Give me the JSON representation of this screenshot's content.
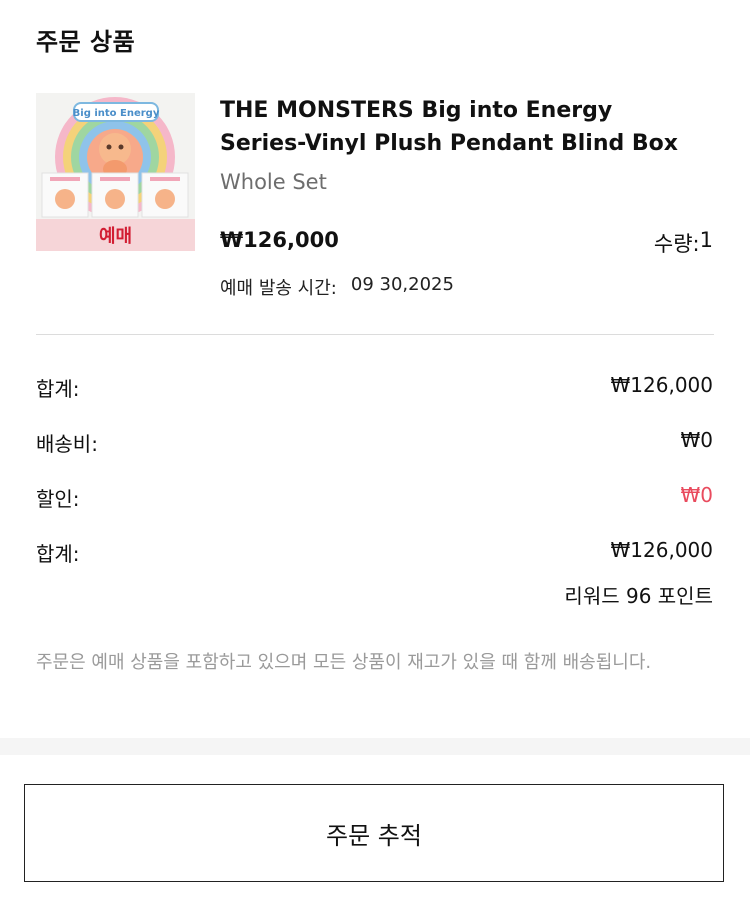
{
  "section_title": "주문 상품",
  "product": {
    "image_icon": "blind-box-product-image",
    "image_logo_text": "Big into Energy",
    "badge": "예매",
    "name": "THE MONSTERS Big into Energy Series-Vinyl Plush Pendant Blind Box",
    "variant": "Whole Set",
    "price": "₩126,000",
    "quantity_label": "수량:",
    "quantity": "1",
    "preorder_ship_label": "예매 발송 시간:",
    "preorder_ship_date": "09 30,2025"
  },
  "summary": {
    "subtotal_label": "합계:",
    "subtotal_value": "₩126,000",
    "shipping_label": "배송비:",
    "shipping_value": "₩0",
    "discount_label": "할인:",
    "discount_value": "₩0",
    "total_label": "합계:",
    "total_value": "₩126,000",
    "reward": "리워드 96 포인트"
  },
  "notice": "주문은 예매 상품을 포함하고 있으며 모든 상품이 재고가 있을 때 함께 배송됩니다.",
  "track_button_label": "주문 추적",
  "colors": {
    "discount": "#e94b5e",
    "badge_text": "#d21e33",
    "badge_bg": "#f6d5d8"
  }
}
